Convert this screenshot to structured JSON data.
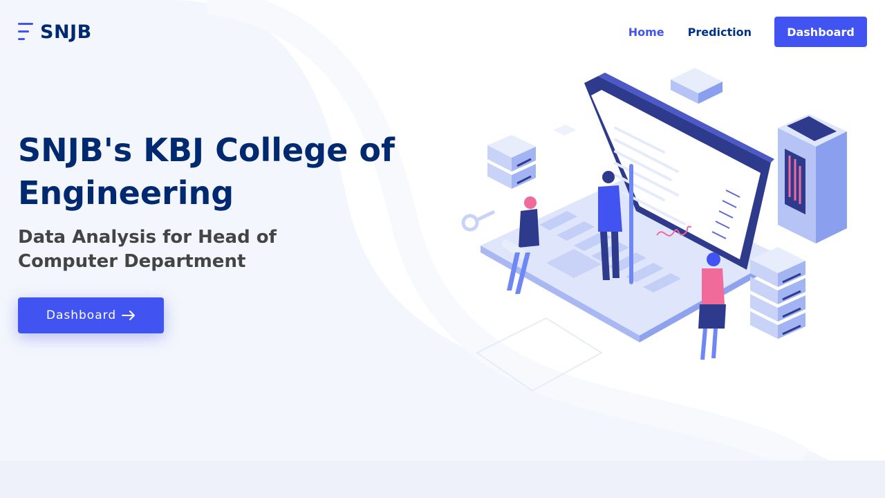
{
  "brand": {
    "logo_text": "SNJB"
  },
  "nav": {
    "home": "Home",
    "prediction": "Prediction",
    "dashboard": "Dashboard"
  },
  "hero": {
    "title": "SNJB's KBJ College of Engineering",
    "subtitle": "Data Analysis for Head of Computer Department",
    "cta_label": "Dashboard"
  },
  "illustration": {
    "name": "laptop-team-illustration"
  },
  "colors": {
    "accent": "#4154f1",
    "heading": "#012970",
    "nav_text": "#013289",
    "body_text": "#444444",
    "page_bg": "#ffffff",
    "soft_bg": "#f2f5fc"
  }
}
